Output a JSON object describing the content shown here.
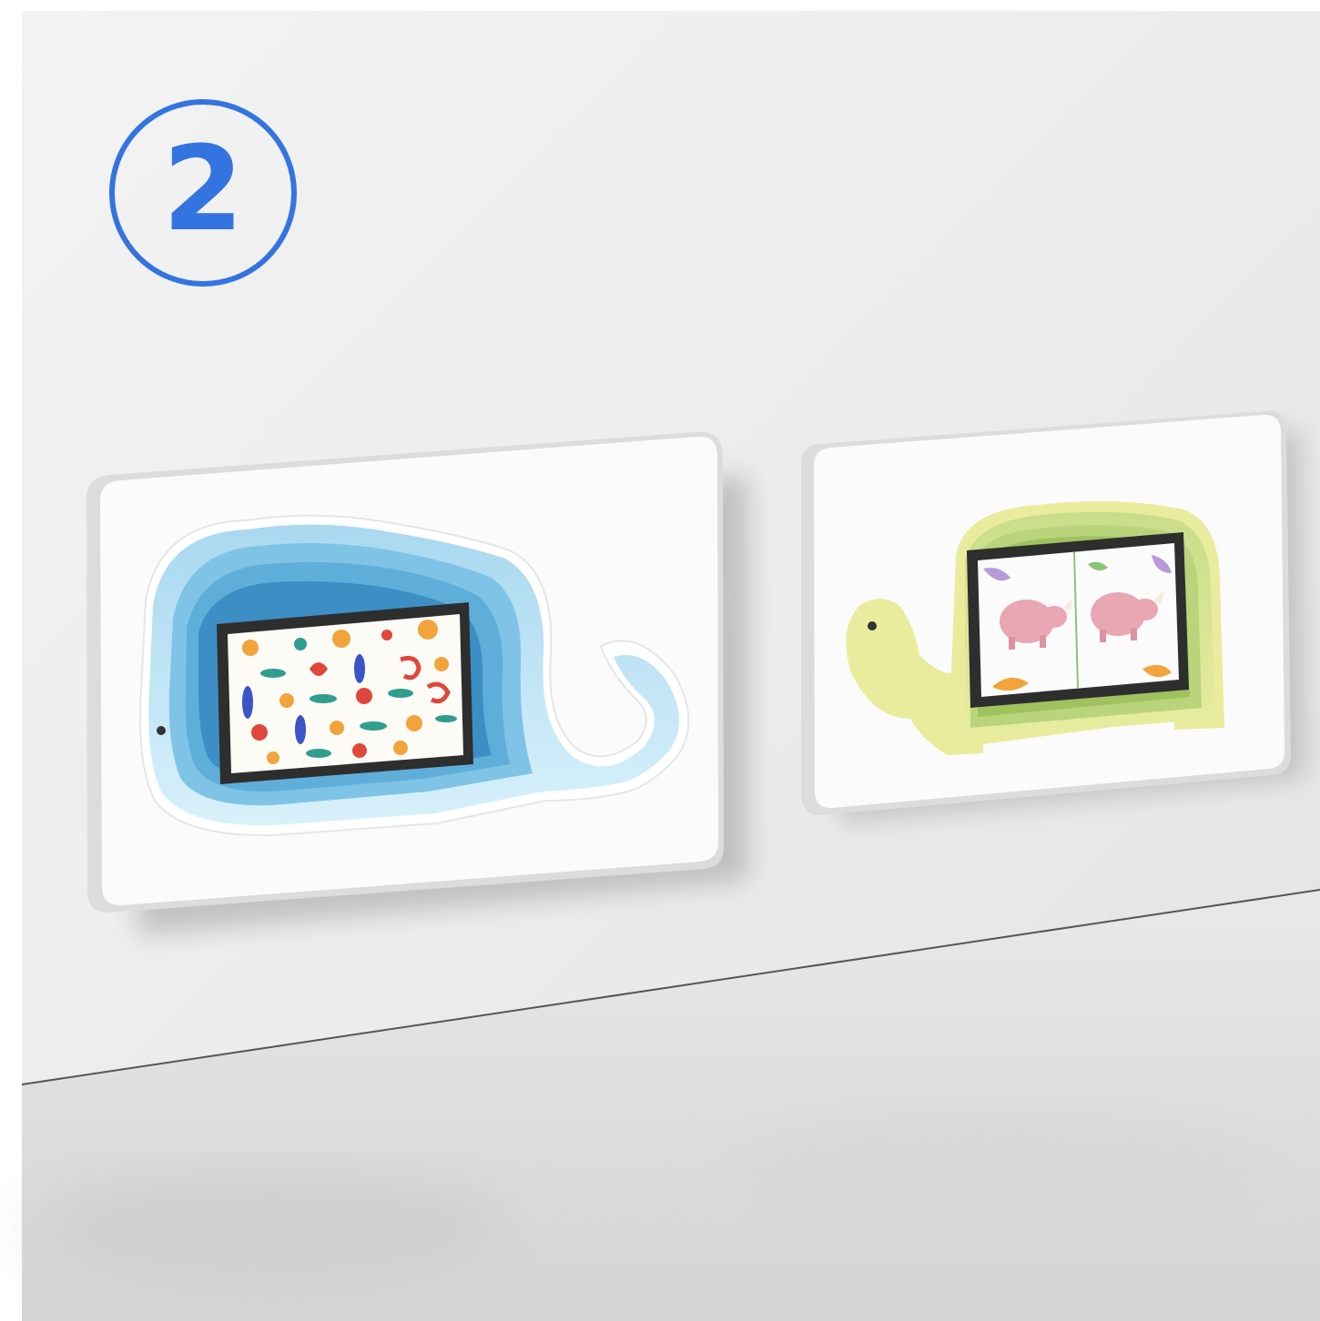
{
  "step_badge": {
    "number": "2",
    "color": "#3474e0"
  },
  "scene": {
    "description_tags": [
      "whale-tablet-kiosk",
      "turtle-tablet-kiosk"
    ],
    "colors": {
      "wall": "#eeeeee",
      "panel": "#fbfbfb",
      "whale_blue": "#7fc3e6",
      "turtle_green": "#b9d47a",
      "turtle_yellow": "#e9ec9c",
      "bezel": "#2e2e2e"
    }
  }
}
